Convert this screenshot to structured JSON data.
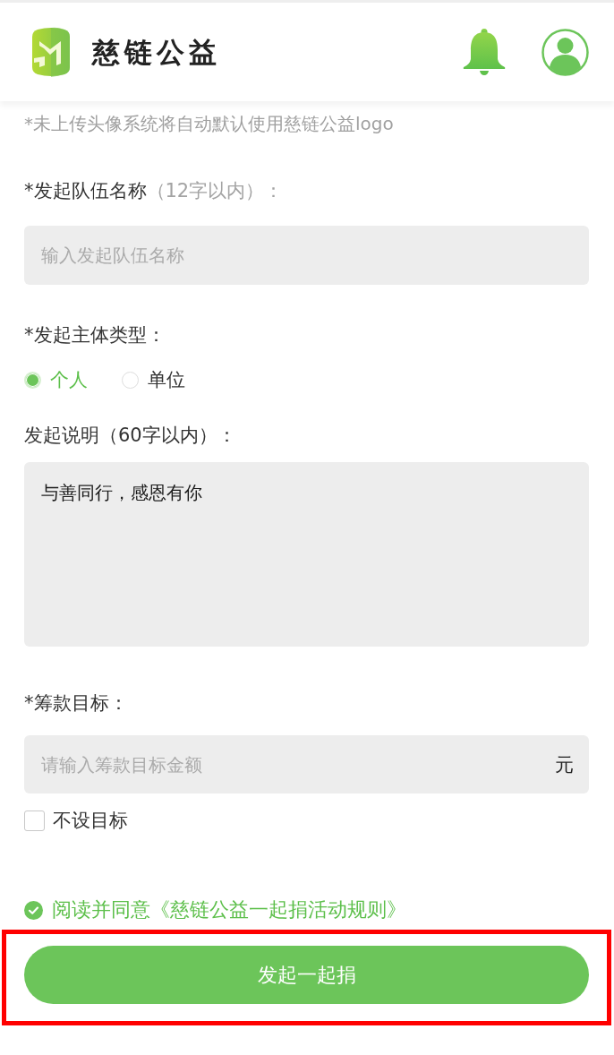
{
  "header": {
    "brand": "慈链公益"
  },
  "avatar_note": "*未上传头像系统将自动默认使用慈链公益logo",
  "fields": [
    {
      "kind": "text",
      "label": "*发起队伍名称",
      "hint": "（12字以内）：",
      "placeholder": "输入发起队伍名称"
    },
    {
      "kind": "radio",
      "label": "*发起主体类型：",
      "options": [
        {
          "label": "个人",
          "selected": true
        },
        {
          "label": "单位",
          "selected": false
        }
      ]
    },
    {
      "kind": "textarea",
      "label": "发起说明（60字以内）：",
      "value": "与善同行，感恩有你"
    },
    {
      "kind": "amount",
      "label": "*筹款目标：",
      "placeholder": "请输入筹款目标金额",
      "suffix": "元",
      "option": {
        "label": "不设目标",
        "checked": false
      }
    }
  ],
  "agreement": {
    "text": "阅读并同意《慈链公益一起捐活动规则》",
    "checked": true
  },
  "submit": {
    "label": "发起一起捐",
    "highlighted": true
  }
}
